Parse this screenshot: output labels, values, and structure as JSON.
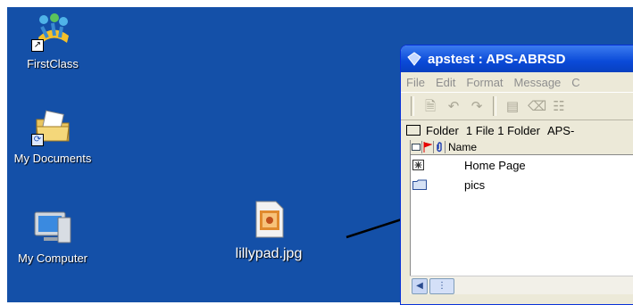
{
  "desktop": {
    "icons": [
      {
        "label": "FirstClass",
        "icon": "firstclass-icon"
      },
      {
        "label": "My Documents",
        "icon": "my-documents-icon"
      },
      {
        "label": "My Computer",
        "icon": "my-computer-icon"
      },
      {
        "label": "lillypad.jpg",
        "icon": "jpg-file-icon"
      }
    ]
  },
  "window": {
    "title": "apstest : APS-ABRSD",
    "menu": [
      "File",
      "Edit",
      "Format",
      "Message",
      "C"
    ],
    "status": {
      "folder_label": "Folder",
      "counts": "1 File 1 Folder",
      "path": "APS-"
    },
    "columns": {
      "name": "Name"
    },
    "rows": [
      {
        "name": "Home Page",
        "icon": "home-page-icon"
      },
      {
        "name": "pics",
        "icon": "folder-icon"
      }
    ]
  },
  "colors": {
    "desktop": "#1450a8",
    "titlebar": "#0a4ad8",
    "window": "#ece9d8"
  }
}
